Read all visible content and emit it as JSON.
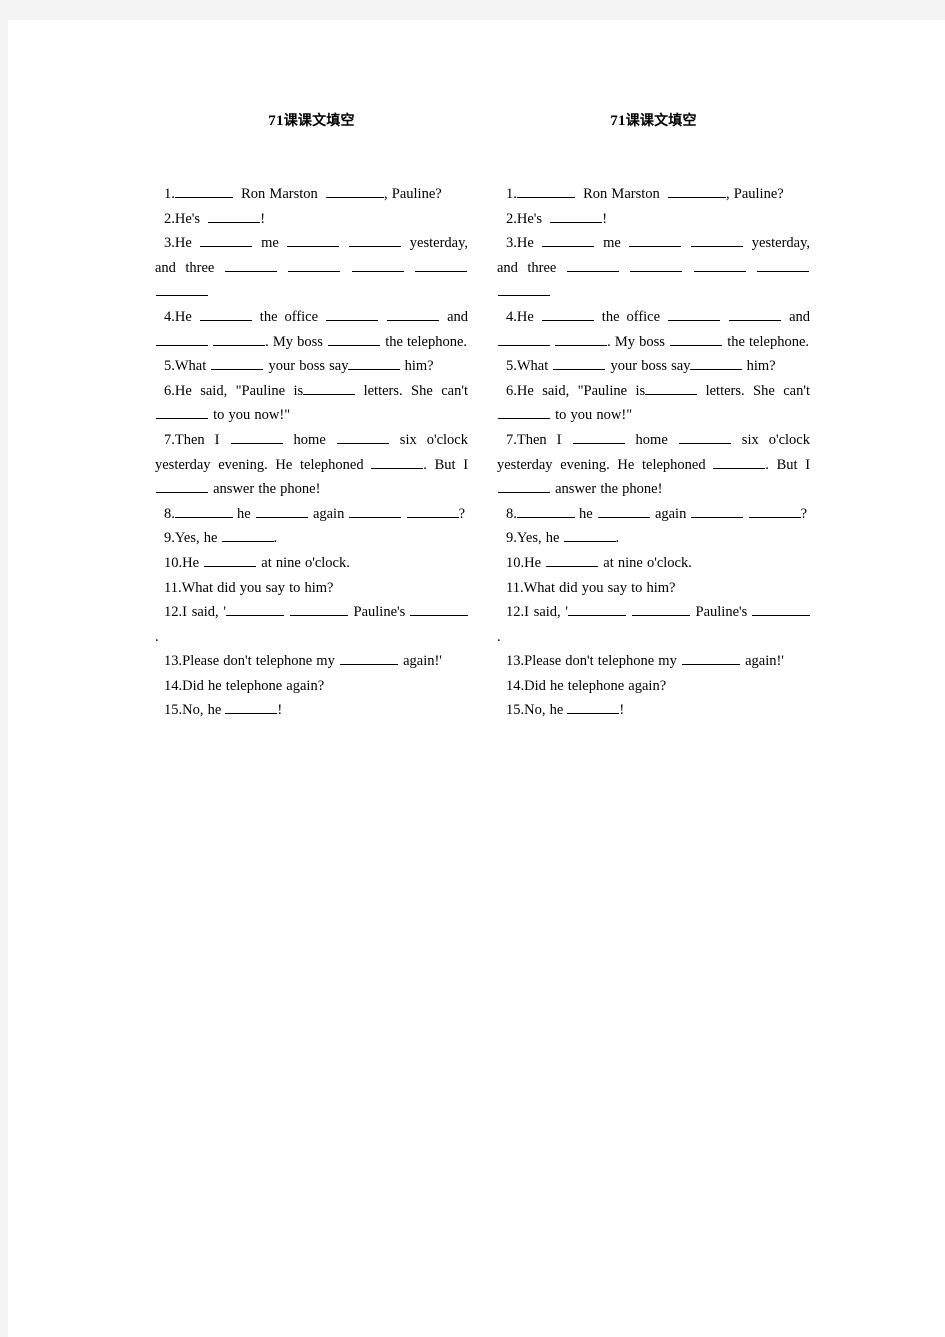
{
  "document": {
    "page_background": "#ffffff",
    "surround_background": "#f4f4f4",
    "text_color": "#000000",
    "columns_count": 2
  },
  "title": {
    "number": "71",
    "cjk": "课课文填空",
    "full": "71课课文填空"
  },
  "exercise": {
    "items": [
      {
        "n": "1.",
        "text": "1._______ Ron Marston _______, Pauline?"
      },
      {
        "n": "2.",
        "text": "2.He's ______!"
      },
      {
        "n": "3.",
        "text": "3.He ______ me ______ ______ yesterday, and three ______ ______ ______ ______ ______"
      },
      {
        "n": "4.",
        "text": "4.He ______ the office ______ ______ and ______ ______. My boss ______ the telephone."
      },
      {
        "n": "5.",
        "text": "5.What ______ your boss say______ him?"
      },
      {
        "n": "6.",
        "text": "6.He said, \"Pauline is______ letters. She can't ______ to you now!\""
      },
      {
        "n": "7.",
        "text": "7.Then I ______ home ______ six o'clock yesterday evening. He telephoned ______. But I ______ answer the phone!"
      },
      {
        "n": "8.",
        "text": "8.______ he ______ again ______ ______?"
      },
      {
        "n": "9.",
        "text": "9.Yes, he ______."
      },
      {
        "n": "10.",
        "text": "10.He ______ at nine o'clock."
      },
      {
        "n": "11.",
        "text": "11.What did you say to him?"
      },
      {
        "n": "12.",
        "text": "12.I said, '______ ______ Pauline's ______."
      },
      {
        "n": "13.",
        "text": "13.Please don't telephone my ______ again!'"
      },
      {
        "n": "14.",
        "text": "14.Did he telephone again?"
      },
      {
        "n": "15.",
        "text": "15.No, he ______!"
      }
    ],
    "words": {
      "i1_a": "Ron",
      "i1_b": "Marston",
      "i1_c": ", Pauline?",
      "i2_a": "2.He's",
      "i2_b": "!",
      "i3_a": "3.He",
      "i3_b": "me",
      "i3_c": "yesterday,",
      "i3_d": "and",
      "i3_e": "three",
      "i4_a": "4.He",
      "i4_b": "the office",
      "i4_c": "and",
      "i4_d": ". My boss",
      "i4_e": "the",
      "i4_f": "telephone.",
      "i5_a": "5.What",
      "i5_b": "your boss say",
      "i5_c": "him?",
      "i6_a": "6.He said, \"Pauline is",
      "i6_b": "letters. She",
      "i6_c": "can't",
      "i6_d": "to you now!\"",
      "i7_a": "7.Then I",
      "i7_b": "home",
      "i7_c": "six o'clock",
      "i7_d": "yesterday evening. He telephoned",
      "i7_e": ".",
      "i7_f": "But I",
      "i7_g": "answer the phone!",
      "i8_a": "8.",
      "i8_b": "he",
      "i8_c": "again",
      "i8_d": "?",
      "i9": "9.Yes, he",
      "i9_end": ".",
      "i10_a": "10.He",
      "i10_b": "at nine o'clock.",
      "i11": "11.What did you say to him?",
      "i12_a": "12.I said, '",
      "i12_b": "Pauline's",
      "i12_c": ".",
      "i13_a": "13.Please don't telephone my",
      "i13_b": "again!'",
      "i14": "14.Did he telephone again?",
      "i15_a": "15.No, he",
      "i15_b": "!"
    }
  }
}
